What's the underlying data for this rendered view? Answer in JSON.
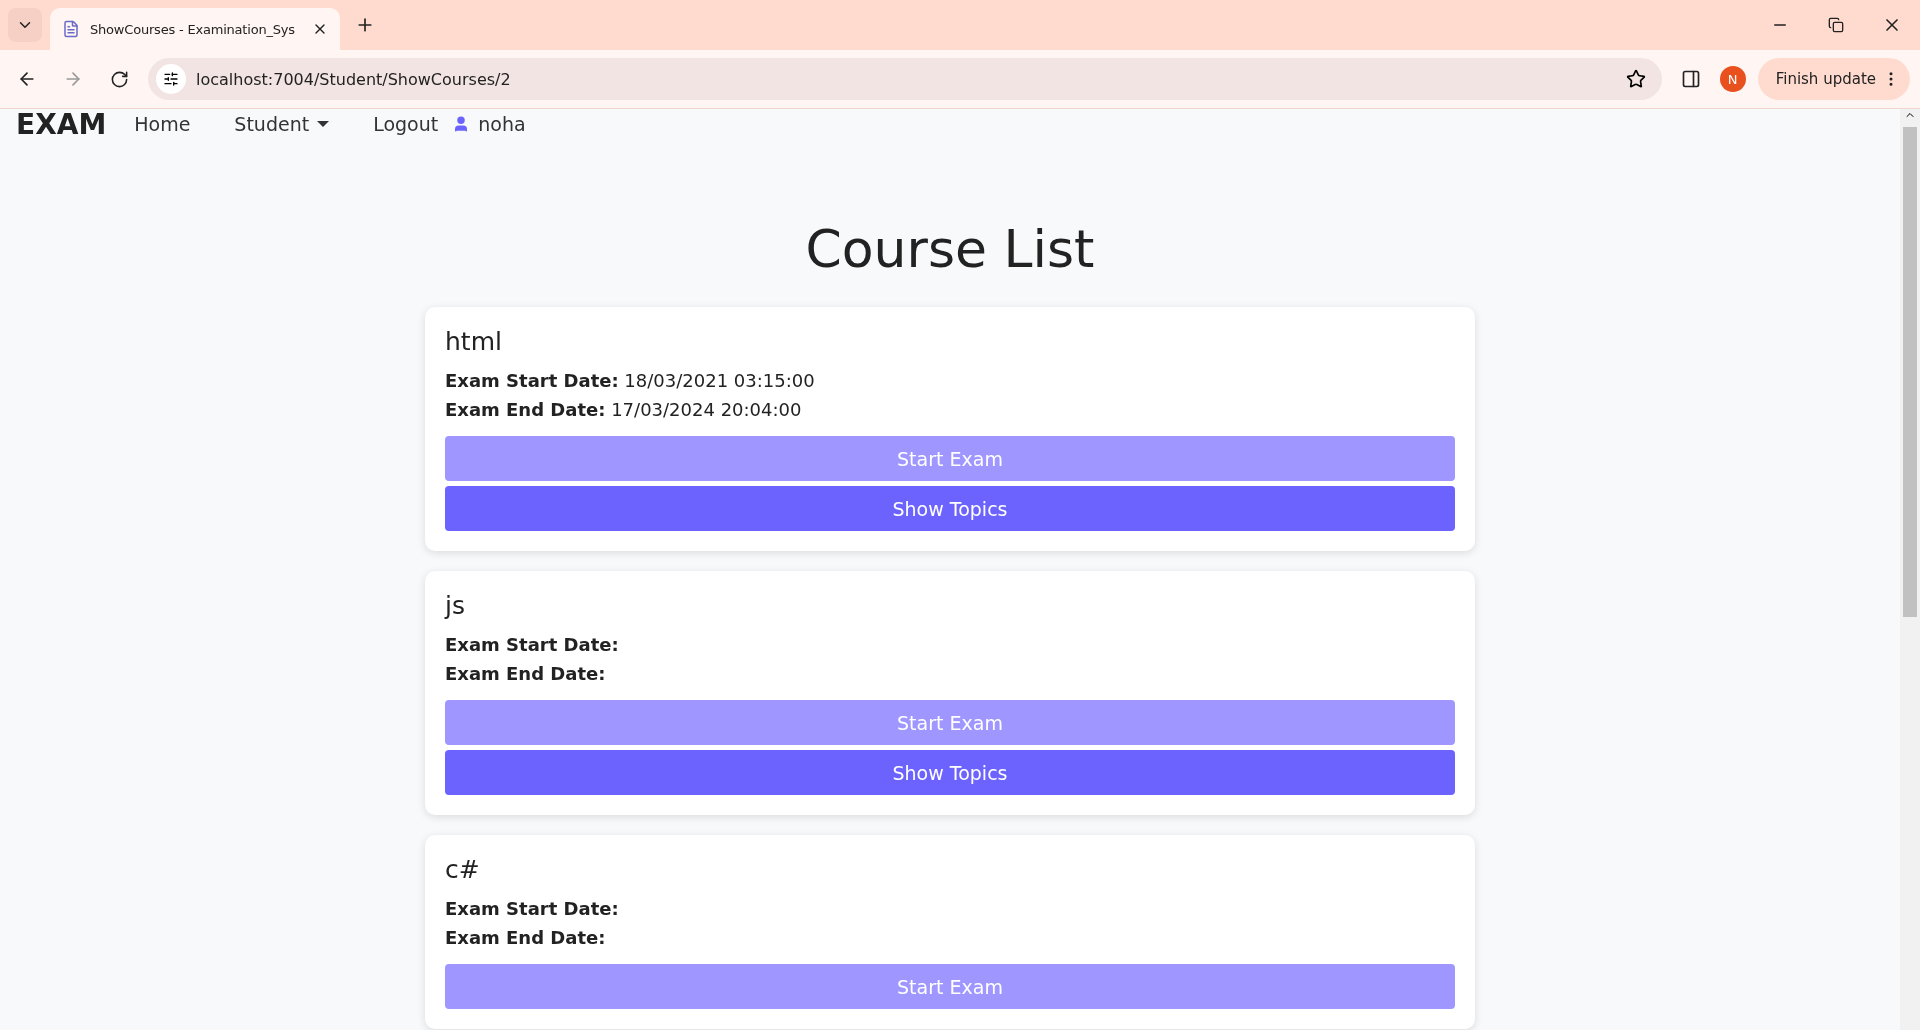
{
  "browser": {
    "tab_title": "ShowCourses - Examination_Sys",
    "address": "localhost:7004/Student/ShowCourses/2",
    "profile_initial": "N",
    "update_button": "Finish update"
  },
  "navbar": {
    "brand": "EXAM",
    "links": [
      {
        "label": "Home",
        "kind": "link"
      },
      {
        "label": "Student",
        "kind": "dropdown"
      },
      {
        "label": "Logout",
        "kind": "link"
      },
      {
        "label": "noha",
        "kind": "user"
      }
    ]
  },
  "page": {
    "title": "Course List"
  },
  "courses": [
    {
      "name": "html",
      "dates": [
        {
          "label": "Exam Start Date:",
          "value": "18/03/2021 03:15:00"
        },
        {
          "label": "Exam End Date:",
          "value": "17/03/2024 20:04:00"
        }
      ],
      "buttons": [
        {
          "label": "Start Exam",
          "disabled": true
        },
        {
          "label": "Show Topics",
          "disabled": false
        }
      ]
    },
    {
      "name": "js",
      "dates": [
        {
          "label": "Exam Start Date:"
        },
        {
          "label": "Exam End Date:"
        }
      ],
      "buttons": [
        {
          "label": "Start Exam",
          "disabled": true
        },
        {
          "label": "Show Topics",
          "disabled": false
        }
      ]
    },
    {
      "name": "c#",
      "dates": [
        {
          "label": "Exam Start Date:"
        },
        {
          "label": "Exam End Date:"
        }
      ],
      "buttons": [
        {
          "label": "Start Exam",
          "disabled": true
        }
      ]
    }
  ]
}
